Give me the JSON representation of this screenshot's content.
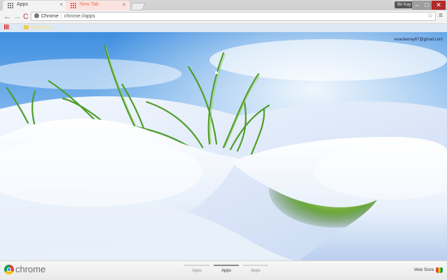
{
  "window": {
    "tabs": [
      {
        "label": "Apps",
        "active": true
      },
      {
        "label": "New Tab",
        "active": false
      }
    ],
    "profile_label": "Bri Kay"
  },
  "toolbar": {
    "omnibox_chip": "Chrome",
    "url": "chrome://apps"
  },
  "bookmarks": {
    "apps_label": "Apps",
    "folder_label": "Bookmarks"
  },
  "content": {
    "user_email": "evanleeray67@gmail.com",
    "prev_icon": "chevron-left-icon",
    "next_icon": "chevron-right-icon"
  },
  "bottom": {
    "brand": "chrome",
    "pages": [
      {
        "label": "Apps",
        "active": false
      },
      {
        "label": "Apps",
        "active": true
      },
      {
        "label": "Apps",
        "active": false
      }
    ],
    "webstore_label": "Web Store"
  },
  "colors": {
    "close_button": "#b22b2b",
    "inactive_tab_text": "#e8735c"
  }
}
